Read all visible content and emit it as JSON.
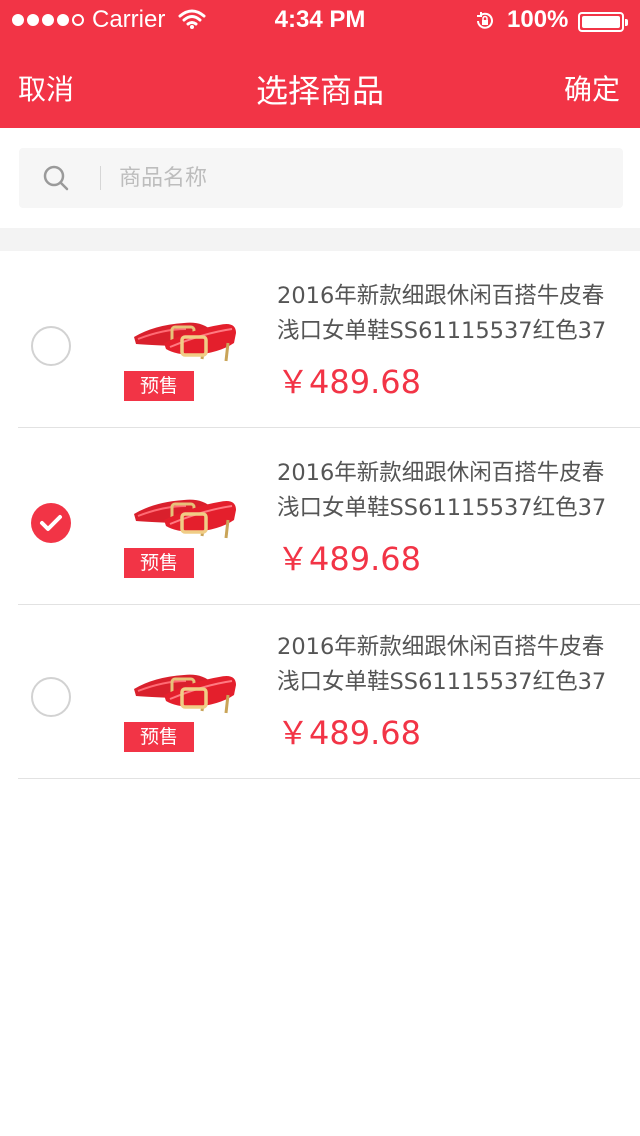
{
  "status_bar": {
    "carrier": "Carrier",
    "time": "4:34 PM",
    "battery": "100%",
    "signal_dots_filled": 4,
    "signal_dots_total": 5
  },
  "nav": {
    "cancel": "取消",
    "title": "选择商品",
    "confirm": "确定"
  },
  "search": {
    "placeholder": "商品名称",
    "value": ""
  },
  "items": [
    {
      "title_line1": "2016年新款细跟休闲百搭牛皮春",
      "title_line2": "浅口女单鞋SS61115537红色37",
      "price": "￥489.68",
      "tag": "预售",
      "checked": false
    },
    {
      "title_line1": "2016年新款细跟休闲百搭牛皮春",
      "title_line2": "浅口女单鞋SS61115537红色37",
      "price": "￥489.68",
      "tag": "预售",
      "checked": true
    },
    {
      "title_line1": "2016年新款细跟休闲百搭牛皮春",
      "title_line2": "浅口女单鞋SS61115537红色37",
      "price": "￥489.68",
      "tag": "预售",
      "checked": false
    }
  ],
  "colors": {
    "accent": "#f23446",
    "text": "#555555",
    "placeholder": "#bdbdbd",
    "divider": "#e2e2e2"
  },
  "icons": [
    "search-icon",
    "wifi-icon",
    "rotation-lock-icon",
    "battery-icon",
    "check-icon",
    "shoe-image"
  ]
}
